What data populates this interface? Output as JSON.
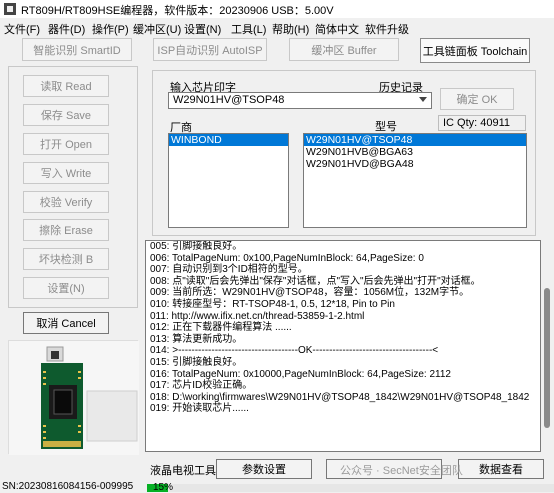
{
  "title": "RT809H/RT809HSE编程器，软件版本：20230906  USB：5.00V",
  "menu": [
    "文件(F)",
    "器件(D)",
    "操作(P)",
    "缓冲区(U)",
    "设置(N)",
    "工具(L)",
    "帮助(H)",
    "简体中文",
    "软件升级"
  ],
  "top_buttons": {
    "smartid": "智能识别 SmartID",
    "isp": "ISP自动识别 AutoISP",
    "buffer": "缓冲区 Buffer",
    "toolchain": "工具链面板 Toolchain"
  },
  "side_buttons": [
    "读取 Read",
    "保存 Save",
    "打开 Open",
    "写入 Write",
    "校验 Verify",
    "擦除 Erase",
    "坏块检测 B",
    "设置(N)"
  ],
  "cancel": "取消 Cancel",
  "chip": {
    "input_label": "输入芯片印字",
    "history_label": "历史记录",
    "value": "W29N01HV@TSOP48",
    "ok": "确定 OK",
    "ic_qty": "IC Qty: 40911",
    "vendor_label": "厂商",
    "model_label": "型号",
    "vendors": [
      "WINBOND"
    ],
    "models": [
      "W29N01HV@TSOP48",
      "W29N01HVB@BGA63",
      "W29N01HVD@BGA48"
    ]
  },
  "log": [
    "005: 引脚接触良好。",
    "006: TotalPageNum: 0x100,PageNumInBlock: 64,PageSize: 0",
    "007: 自动识别到3个ID相符的型号。",
    "008: 点\"读取\"后会先弹出\"保存\"对话框，点\"写入\"后会先弹出\"打开\"对话框。",
    "009: 当前所选：W29N01HV@TSOP48，容量：1056M位，132M字节。",
    "010: 转接座型号：RT-TSOP48-1, 0.5, 12*18, Pin to Pin",
    "011: http://www.ifix.net.cn/thread-53859-1-2.html",
    "012: 正在下载器件编程算法 ......",
    "013: 算法更新成功。",
    "014: >------------------------------------OK------------------------------------<",
    "015: 引脚接触良好。",
    "016: TotalPageNum: 0x10000,PageNumInBlock: 64,PageSize: 2112",
    "017: 芯片ID校验正确。",
    "018: D:\\working\\firmwares\\W29N01HV@TSOP48_1842\\W29N01HV@TSOP48_1842",
    "019: 开始读取芯片......"
  ],
  "bottom": {
    "lcd_tool": "液晶电视工具",
    "params": "参数设置",
    "watermark": "公众号 · SecNet安全团队",
    "dev_view": "数据查看"
  },
  "status": {
    "sn": "SN:20230816084156-009995",
    "progress_pct": 15,
    "progress_text": "15%"
  },
  "colors": {
    "selection": "#0078d7",
    "progress": "#06b025"
  }
}
